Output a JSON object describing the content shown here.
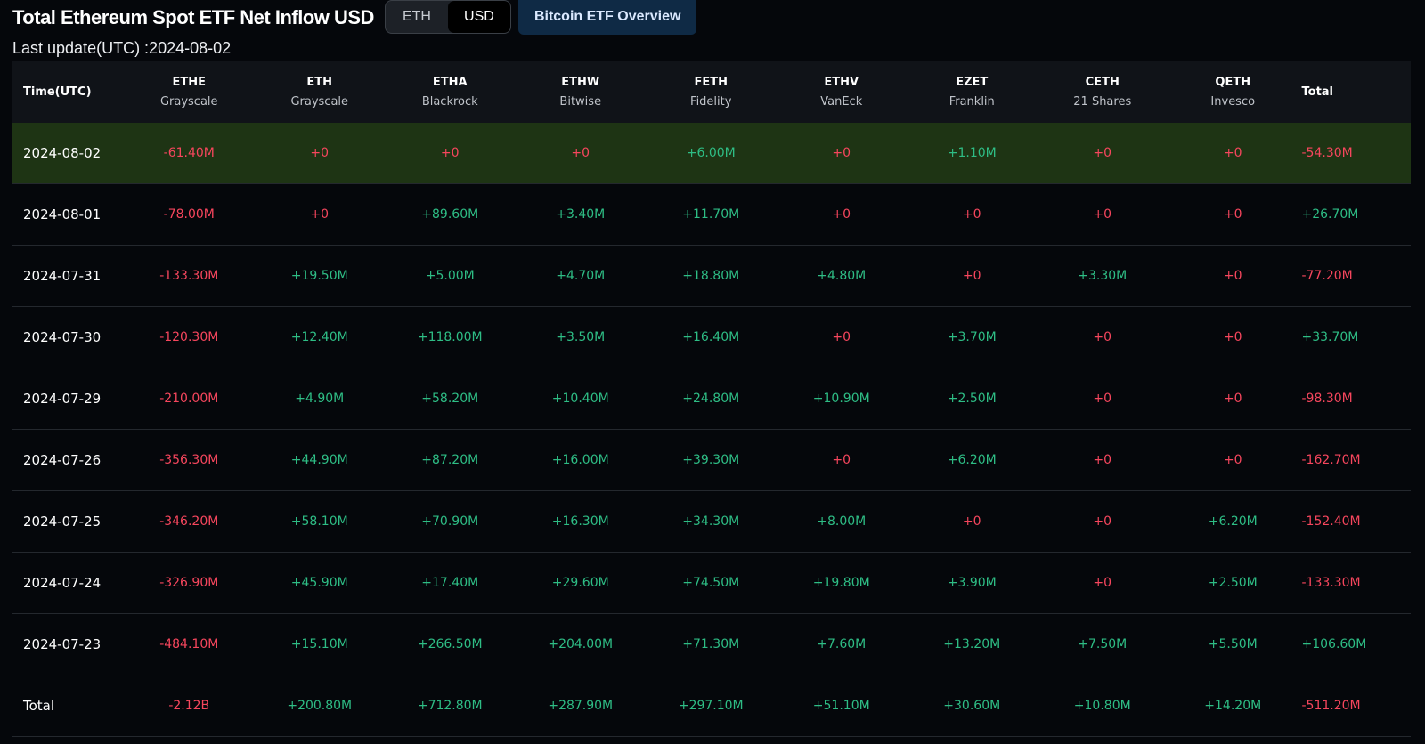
{
  "header": {
    "title": "Total Ethereum Spot ETF Net Inflow USD",
    "toggle": [
      "ETH",
      "USD"
    ],
    "active_toggle": "USD",
    "btc_button": "Bitcoin ETF Overview",
    "subtitle": "Last update(UTC) :2024-08-02"
  },
  "colors": {
    "positive": "#2ebd85",
    "negative": "#f6465d",
    "highlight_row": "#1e3414"
  },
  "table": {
    "columns": [
      {
        "ticker": "Time(UTC)",
        "issuer": ""
      },
      {
        "ticker": "ETHE",
        "issuer": "Grayscale"
      },
      {
        "ticker": "ETH",
        "issuer": "Grayscale"
      },
      {
        "ticker": "ETHA",
        "issuer": "Blackrock"
      },
      {
        "ticker": "ETHW",
        "issuer": "Bitwise"
      },
      {
        "ticker": "FETH",
        "issuer": "Fidelity"
      },
      {
        "ticker": "ETHV",
        "issuer": "VanEck"
      },
      {
        "ticker": "EZET",
        "issuer": "Franklin"
      },
      {
        "ticker": "CETH",
        "issuer": "21 Shares"
      },
      {
        "ticker": "QETH",
        "issuer": "Invesco"
      },
      {
        "ticker": "Total",
        "issuer": ""
      }
    ],
    "rows": [
      {
        "date": "2024-08-02",
        "highlight": true,
        "values": [
          "-61.40M",
          "+0",
          "+0",
          "+0",
          "+6.00M",
          "+0",
          "+1.10M",
          "+0",
          "+0",
          "-54.30M"
        ]
      },
      {
        "date": "2024-08-01",
        "values": [
          "-78.00M",
          "+0",
          "+89.60M",
          "+3.40M",
          "+11.70M",
          "+0",
          "+0",
          "+0",
          "+0",
          "+26.70M"
        ]
      },
      {
        "date": "2024-07-31",
        "values": [
          "-133.30M",
          "+19.50M",
          "+5.00M",
          "+4.70M",
          "+18.80M",
          "+4.80M",
          "+0",
          "+3.30M",
          "+0",
          "-77.20M"
        ]
      },
      {
        "date": "2024-07-30",
        "values": [
          "-120.30M",
          "+12.40M",
          "+118.00M",
          "+3.50M",
          "+16.40M",
          "+0",
          "+3.70M",
          "+0",
          "+0",
          "+33.70M"
        ]
      },
      {
        "date": "2024-07-29",
        "values": [
          "-210.00M",
          "+4.90M",
          "+58.20M",
          "+10.40M",
          "+24.80M",
          "+10.90M",
          "+2.50M",
          "+0",
          "+0",
          "-98.30M"
        ]
      },
      {
        "date": "2024-07-26",
        "values": [
          "-356.30M",
          "+44.90M",
          "+87.20M",
          "+16.00M",
          "+39.30M",
          "+0",
          "+6.20M",
          "+0",
          "+0",
          "-162.70M"
        ]
      },
      {
        "date": "2024-07-25",
        "values": [
          "-346.20M",
          "+58.10M",
          "+70.90M",
          "+16.30M",
          "+34.30M",
          "+8.00M",
          "+0",
          "+0",
          "+6.20M",
          "-152.40M"
        ]
      },
      {
        "date": "2024-07-24",
        "values": [
          "-326.90M",
          "+45.90M",
          "+17.40M",
          "+29.60M",
          "+74.50M",
          "+19.80M",
          "+3.90M",
          "+0",
          "+2.50M",
          "-133.30M"
        ]
      },
      {
        "date": "2024-07-23",
        "values": [
          "-484.10M",
          "+15.10M",
          "+266.50M",
          "+204.00M",
          "+71.30M",
          "+7.60M",
          "+13.20M",
          "+7.50M",
          "+5.50M",
          "+106.60M"
        ]
      },
      {
        "date": "Total",
        "values": [
          "-2.12B",
          "+200.80M",
          "+712.80M",
          "+287.90M",
          "+297.10M",
          "+51.10M",
          "+30.60M",
          "+10.80M",
          "+14.20M",
          "-511.20M"
        ]
      }
    ],
    "zero_value_color": "negative"
  }
}
